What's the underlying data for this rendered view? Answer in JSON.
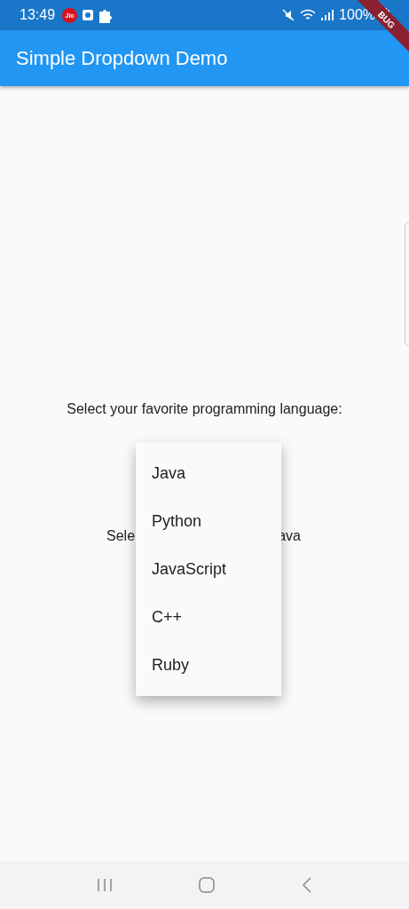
{
  "status_bar": {
    "time": "13:49",
    "carrier_badge": "Jio",
    "battery": "100%"
  },
  "debug_banner": "BUG",
  "app_bar": {
    "title": "Simple Dropdown Demo"
  },
  "prompt": "Select your favorite programming language:",
  "selected_text": {
    "visible_left": "Sele",
    "visible_right": "ava"
  },
  "dropdown_menu": {
    "items": [
      {
        "label": "Java"
      },
      {
        "label": "Python"
      },
      {
        "label": "JavaScript"
      },
      {
        "label": "C++"
      },
      {
        "label": "Ruby"
      }
    ]
  }
}
